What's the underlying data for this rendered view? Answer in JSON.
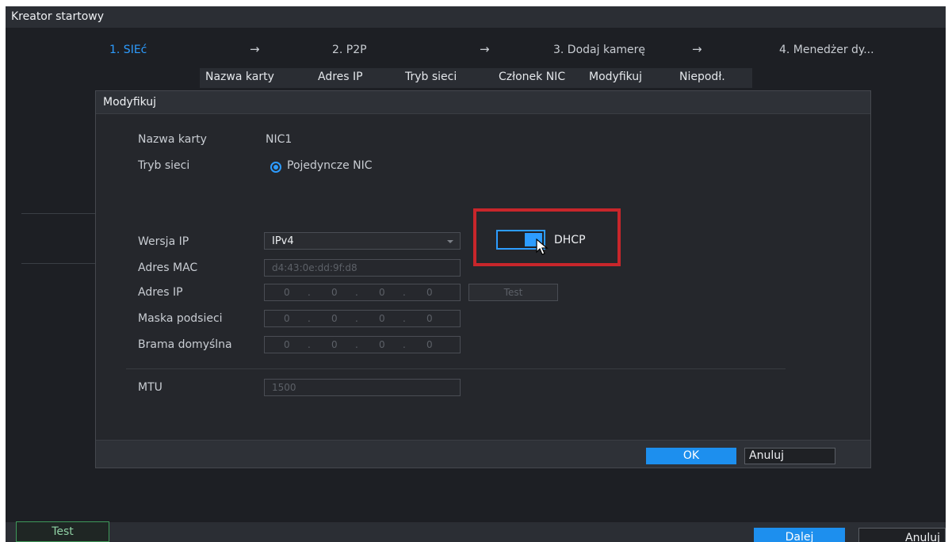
{
  "window": {
    "title": "Kreator startowy"
  },
  "steps": [
    {
      "label": "1. SIEć"
    },
    {
      "label": "2. P2P"
    },
    {
      "label": "3. Dodaj kamerę"
    },
    {
      "label": "4. Menedżer dy..."
    }
  ],
  "arrow_glyph": "→",
  "table_columns": [
    "Nazwa karty",
    "Adres IP",
    "Tryb sieci",
    "Członek NIC",
    "Modyfikuj",
    "Niepodł."
  ],
  "modal": {
    "title": "Modyfikuj",
    "card_name_label": "Nazwa karty",
    "card_name_value": "NIC1",
    "network_mode_label": "Tryb sieci",
    "network_mode_option": "Pojedyncze NIC",
    "ip_version_label": "Wersja IP",
    "ip_version_value": "IPv4",
    "dhcp_label": "DHCP",
    "dhcp_enabled": true,
    "mac_label": "Adres MAC",
    "mac_value": "d4:43:0e:dd:9f:d8",
    "ip_label": "Adres IP",
    "ip_value": [
      "0",
      "0",
      "0",
      "0"
    ],
    "test_button": "Test",
    "mask_label": "Maska podsieci",
    "mask_value": [
      "0",
      "0",
      "0",
      "0"
    ],
    "gateway_label": "Brama domyślna",
    "gateway_value": [
      "0",
      "0",
      "0",
      "0"
    ],
    "mtu_label": "MTU",
    "mtu_value": "1500",
    "ok_button": "OK",
    "cancel_button": "Anuluj"
  },
  "footer": {
    "test_button": "Test",
    "next_button": "Dalej",
    "cancel_button": "Anuluj"
  },
  "colors": {
    "accent": "#2d9cff",
    "highlight_box": "#c8262b",
    "background": "#1d1f24"
  }
}
